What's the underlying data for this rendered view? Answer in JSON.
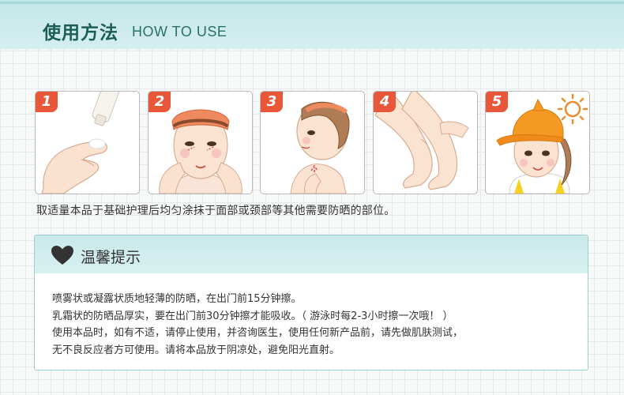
{
  "header": {
    "title_cn": "使用方法",
    "title_en": "HOW TO USE"
  },
  "steps": [
    {
      "number": "1"
    },
    {
      "number": "2"
    },
    {
      "number": "3"
    },
    {
      "number": "4"
    },
    {
      "number": "5"
    }
  ],
  "instruction": "取适量本品于基础护理后均匀涂抹于面部或颈部等其他需要防晒的部位。",
  "tips": {
    "title": "温馨提示",
    "lines": [
      "喷雾状或凝露状质地轻薄的防晒，在出门前15分钟擦。",
      "乳霜状的防晒品厚实，要在出门前30分钟擦才能吸收。（ 游泳时每2-3小时擦一次哦！ ）",
      "使用本品时，如有不适，请停止使用，并咨询医生，使用任何新产品前，请先做肌肤测试，",
      "无不良反应者方可使用。请将本品放于阴凉处，避免阳光直射。"
    ]
  },
  "colors": {
    "header_bg": "#c4e7e8",
    "title_text": "#1c5d55",
    "badge": "#e8573a",
    "tips_border": "#9ccfcf"
  },
  "icons": [
    "heart-icon",
    "sun-icon"
  ]
}
